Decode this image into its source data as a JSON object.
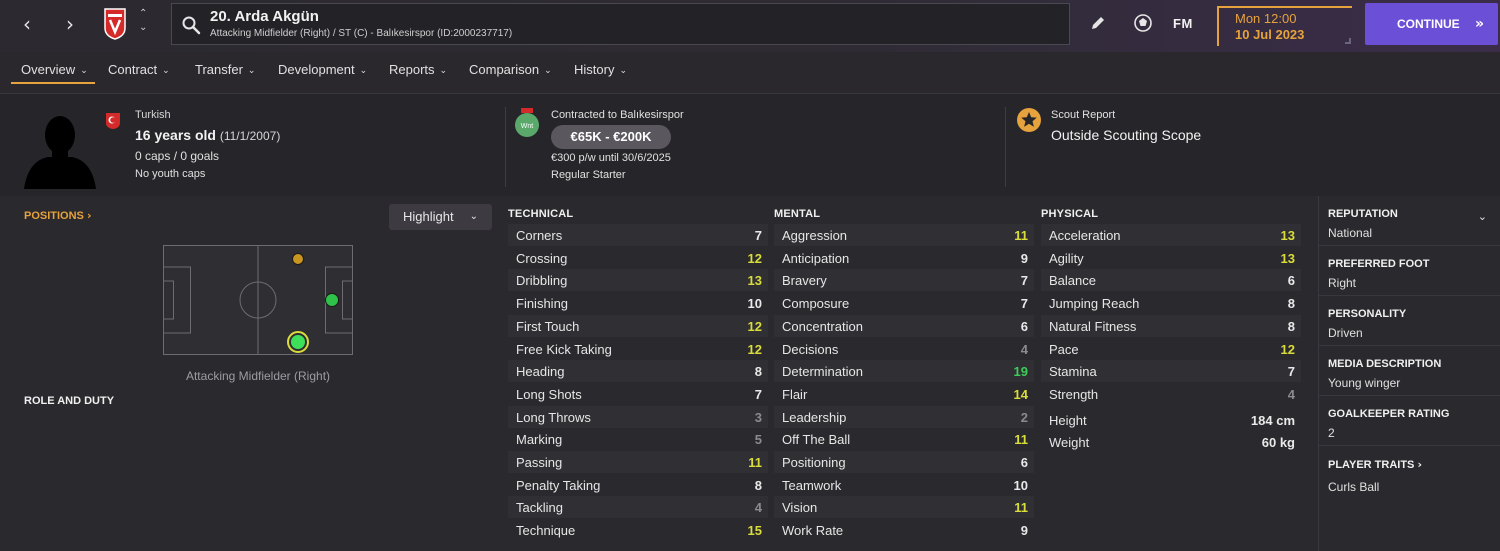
{
  "header": {
    "player_title": "20. Arda Akgün",
    "player_subtitle": "Attacking Midfielder (Right) / ST (C) - Balıkesirspor (ID:2000237717)",
    "fm_logo": "FM",
    "date_day": "Mon 12:00",
    "date_date": "10 Jul 2023",
    "continue_label": "CONTINUE",
    "accent_color": "#e6a23c",
    "continue_color": "#6b4fd6"
  },
  "tabs": [
    {
      "label": "Overview"
    },
    {
      "label": "Contract"
    },
    {
      "label": "Transfer"
    },
    {
      "label": "Development"
    },
    {
      "label": "Reports"
    },
    {
      "label": "Comparison"
    },
    {
      "label": "History"
    }
  ],
  "info": {
    "nationality": "Turkish",
    "age": "16 years old",
    "dob": "(11/1/2007)",
    "caps": "0 caps / 0 goals",
    "youth_caps": "No youth caps",
    "contract_title": "Contracted to Balıkesirspor",
    "value": "€65K - €200K",
    "wage": "€300 p/w until 30/6/2025",
    "squad_status": "Regular Starter",
    "scout_title": "Scout Report",
    "scout_value": "Outside Scouting Scope"
  },
  "positions": {
    "label": "POSITIONS",
    "highlight_label": "Highlight",
    "caption": "Attacking Midfielder (Right)",
    "role_label": "ROLE AND DUTY"
  },
  "technical": {
    "heading": "TECHNICAL",
    "rows": [
      {
        "name": "Corners",
        "value": "7"
      },
      {
        "name": "Crossing",
        "value": "12"
      },
      {
        "name": "Dribbling",
        "value": "13"
      },
      {
        "name": "Finishing",
        "value": "10"
      },
      {
        "name": "First Touch",
        "value": "12"
      },
      {
        "name": "Free Kick Taking",
        "value": "12"
      },
      {
        "name": "Heading",
        "value": "8"
      },
      {
        "name": "Long Shots",
        "value": "7"
      },
      {
        "name": "Long Throws",
        "value": "3"
      },
      {
        "name": "Marking",
        "value": "5"
      },
      {
        "name": "Passing",
        "value": "11"
      },
      {
        "name": "Penalty Taking",
        "value": "8"
      },
      {
        "name": "Tackling",
        "value": "4"
      },
      {
        "name": "Technique",
        "value": "15"
      }
    ]
  },
  "mental": {
    "heading": "MENTAL",
    "rows": [
      {
        "name": "Aggression",
        "value": "11"
      },
      {
        "name": "Anticipation",
        "value": "9"
      },
      {
        "name": "Bravery",
        "value": "7"
      },
      {
        "name": "Composure",
        "value": "7"
      },
      {
        "name": "Concentration",
        "value": "6"
      },
      {
        "name": "Decisions",
        "value": "4"
      },
      {
        "name": "Determination",
        "value": "19"
      },
      {
        "name": "Flair",
        "value": "14"
      },
      {
        "name": "Leadership",
        "value": "2"
      },
      {
        "name": "Off The Ball",
        "value": "11"
      },
      {
        "name": "Positioning",
        "value": "6"
      },
      {
        "name": "Teamwork",
        "value": "10"
      },
      {
        "name": "Vision",
        "value": "11"
      },
      {
        "name": "Work Rate",
        "value": "9"
      }
    ]
  },
  "physical": {
    "heading": "PHYSICAL",
    "rows": [
      {
        "name": "Acceleration",
        "value": "13"
      },
      {
        "name": "Agility",
        "value": "13"
      },
      {
        "name": "Balance",
        "value": "6"
      },
      {
        "name": "Jumping Reach",
        "value": "8"
      },
      {
        "name": "Natural Fitness",
        "value": "8"
      },
      {
        "name": "Pace",
        "value": "12"
      },
      {
        "name": "Stamina",
        "value": "7"
      },
      {
        "name": "Strength",
        "value": "4"
      }
    ],
    "height_label": "Height",
    "height_value": "184 cm",
    "weight_label": "Weight",
    "weight_value": "60 kg"
  },
  "side": {
    "reputation_label": "REPUTATION",
    "reputation_value": "National",
    "foot_label": "PREFERRED FOOT",
    "foot_value": "Right",
    "personality_label": "PERSONALITY",
    "personality_value": "Driven",
    "media_label": "MEDIA DESCRIPTION",
    "media_value": "Young winger",
    "gk_label": "GOALKEEPER RATING",
    "gk_value": "2",
    "traits_label": "PLAYER TRAITS",
    "traits_value": "Curls Ball"
  },
  "attribute_colors": {
    "low": "#8c8b90",
    "mid": "#e9e9e9",
    "good": "#d9dd3c",
    "great": "#3ccf58"
  }
}
